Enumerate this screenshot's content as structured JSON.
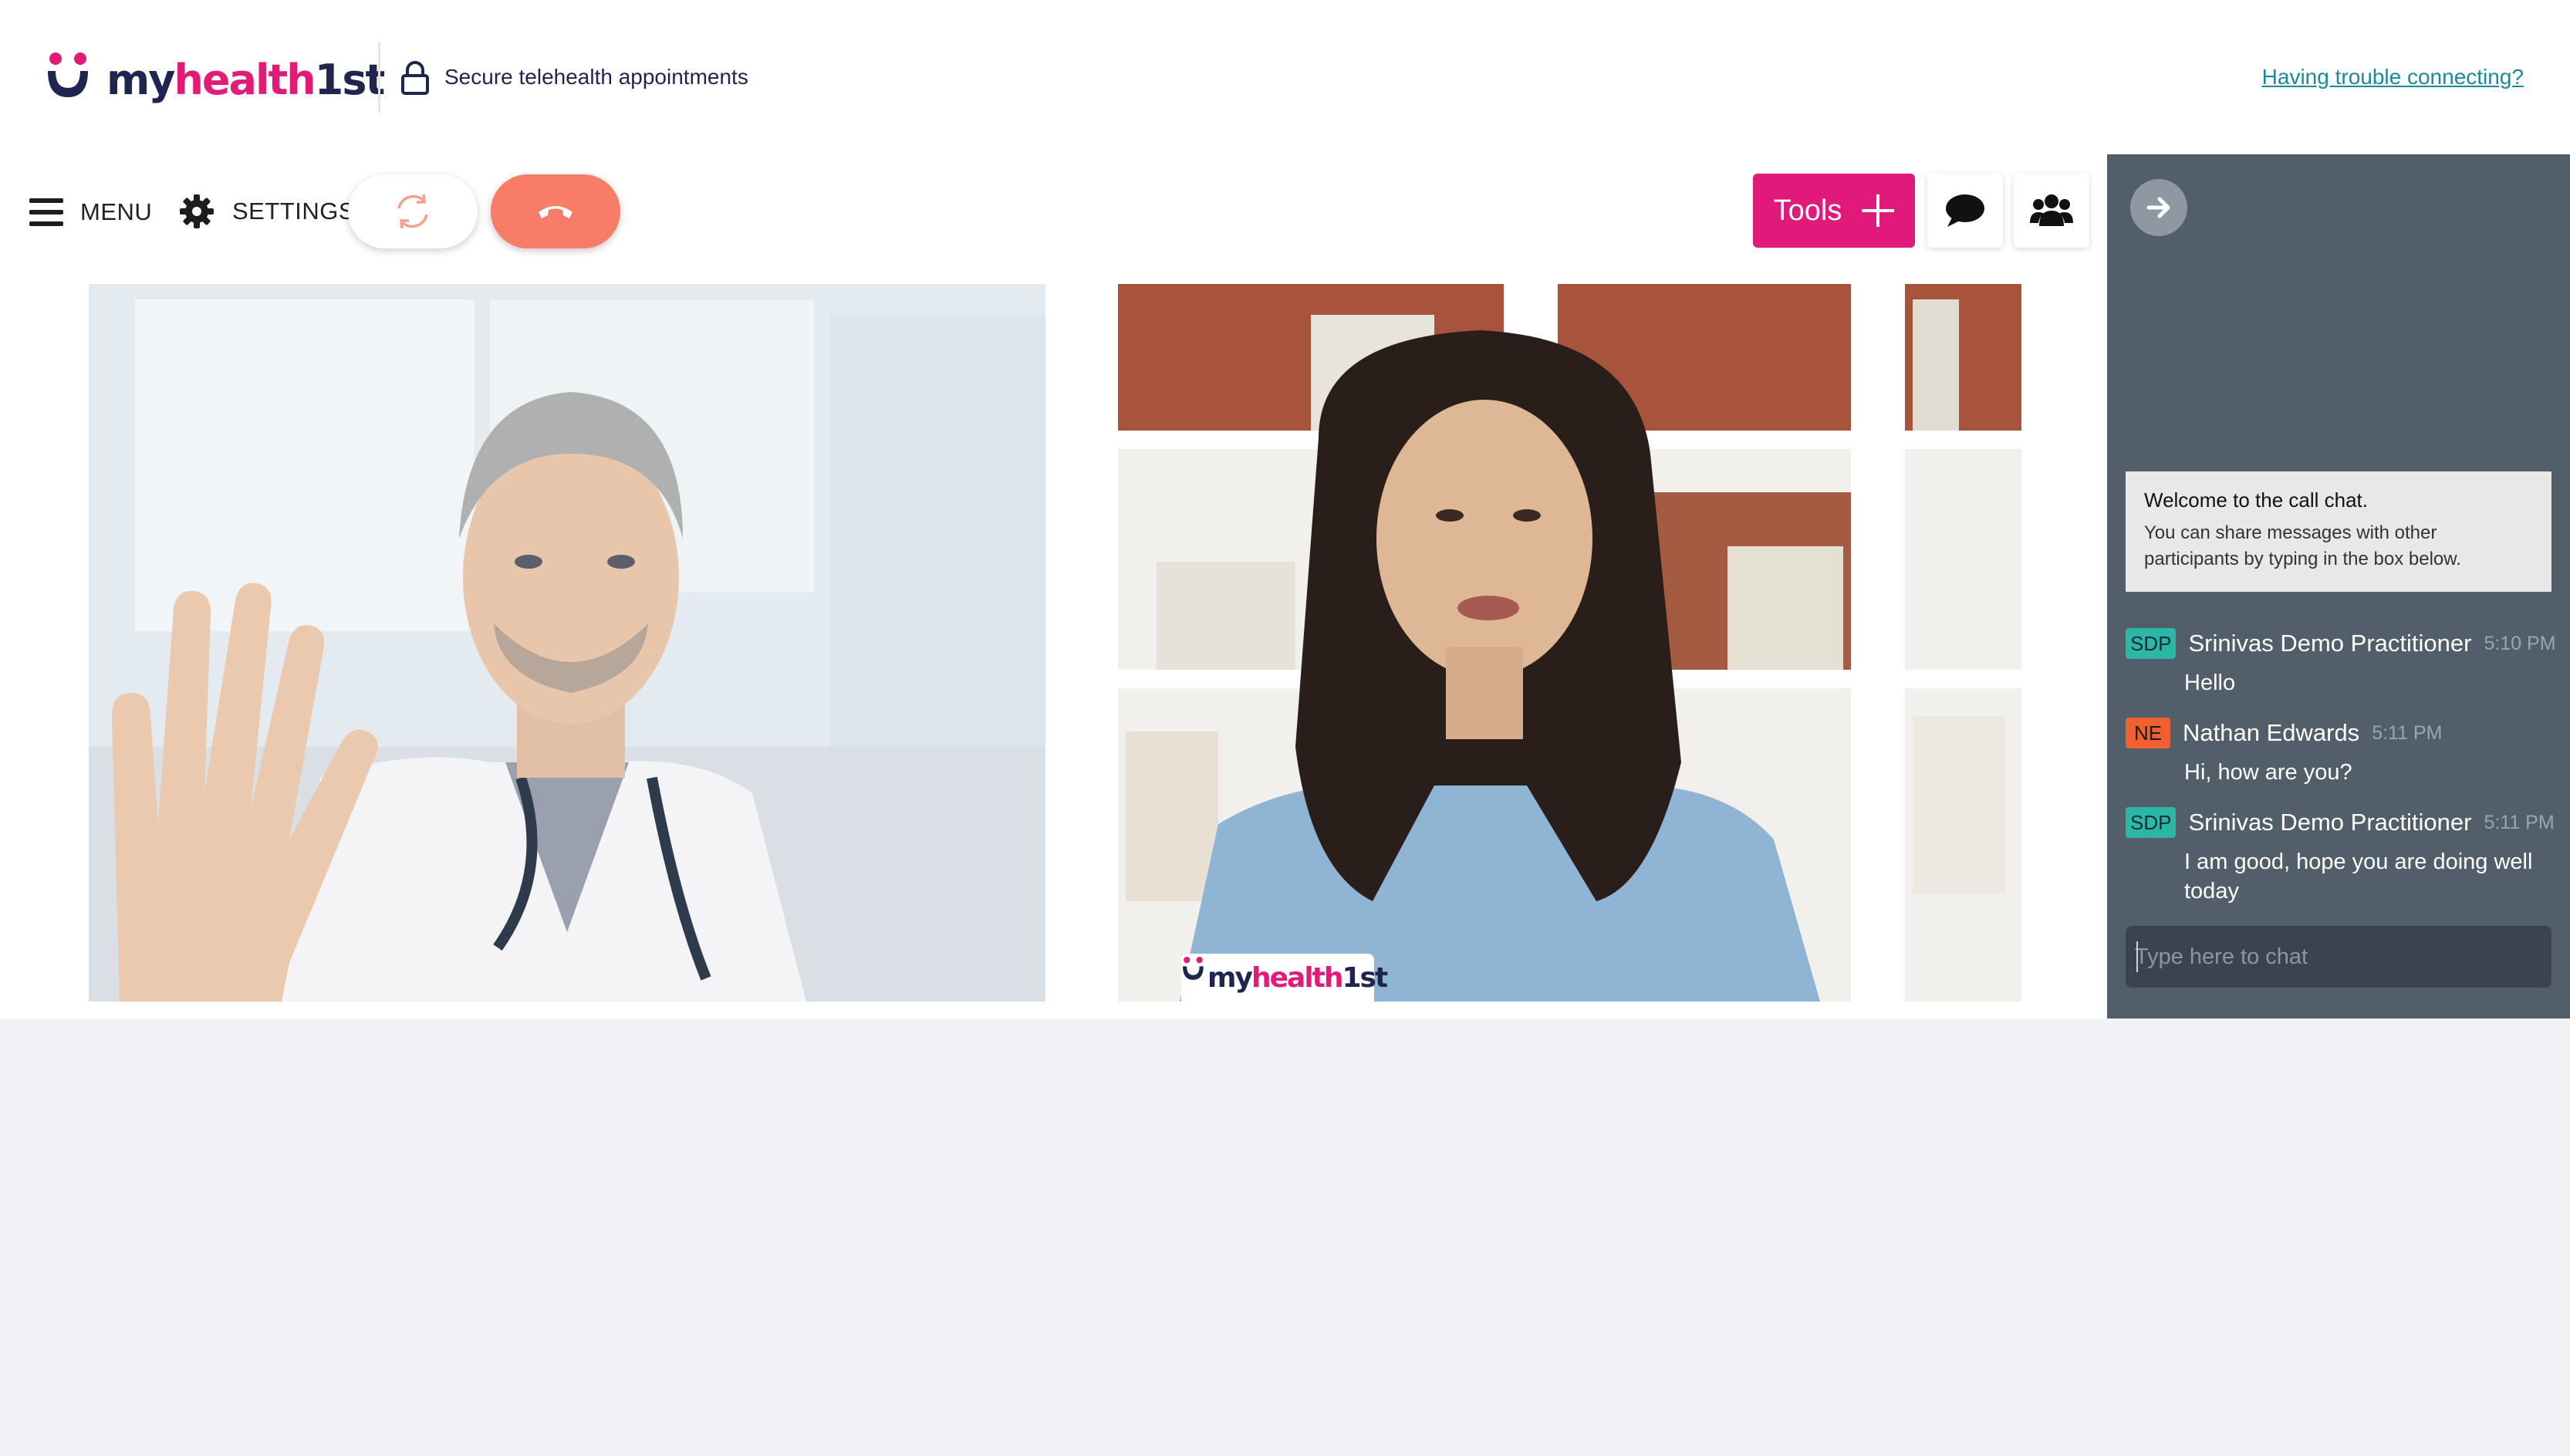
{
  "header": {
    "logo": {
      "my": "my",
      "health": "health",
      "first": "1st"
    },
    "secure_text": "Secure telehealth appointments",
    "trouble_link": "Having trouble connecting?"
  },
  "toolbar": {
    "menu_label": "MENU",
    "settings_label": "SETTINGS",
    "tools_label": "Tools"
  },
  "video": {
    "watermark": {
      "my": "my",
      "health": "health",
      "first": "1st"
    }
  },
  "chat": {
    "welcome_title": "Welcome to the call chat.",
    "welcome_body": "You can share messages with other participants by typing in the box below.",
    "messages": [
      {
        "initials": "SDP",
        "name": "Srinivas Demo Practitioner",
        "time": "5:10 PM",
        "text": "Hello"
      },
      {
        "initials": "NE",
        "name": "Nathan Edwards",
        "time": "5:11 PM",
        "text": "Hi, how are you?"
      },
      {
        "initials": "SDP",
        "name": "Srinivas Demo Practitioner",
        "time": "5:11 PM",
        "text": "I am good, hope you are doing well today"
      }
    ],
    "input_placeholder": "Type here to chat"
  },
  "colors": {
    "brand_pink": "#e0197a",
    "brand_navy": "#1e2650",
    "hangup": "#f87c68",
    "chat_panel": "#525e6a",
    "badge_sdp": "#2bb7a6",
    "badge_ne": "#f06030",
    "link": "#1a8a9a"
  },
  "icons": [
    "lock-icon",
    "menu-icon",
    "gear-icon",
    "refresh-icon",
    "hang-up-icon",
    "plus-icon",
    "chat-bubble-icon",
    "users-icon",
    "arrow-right-icon"
  ]
}
